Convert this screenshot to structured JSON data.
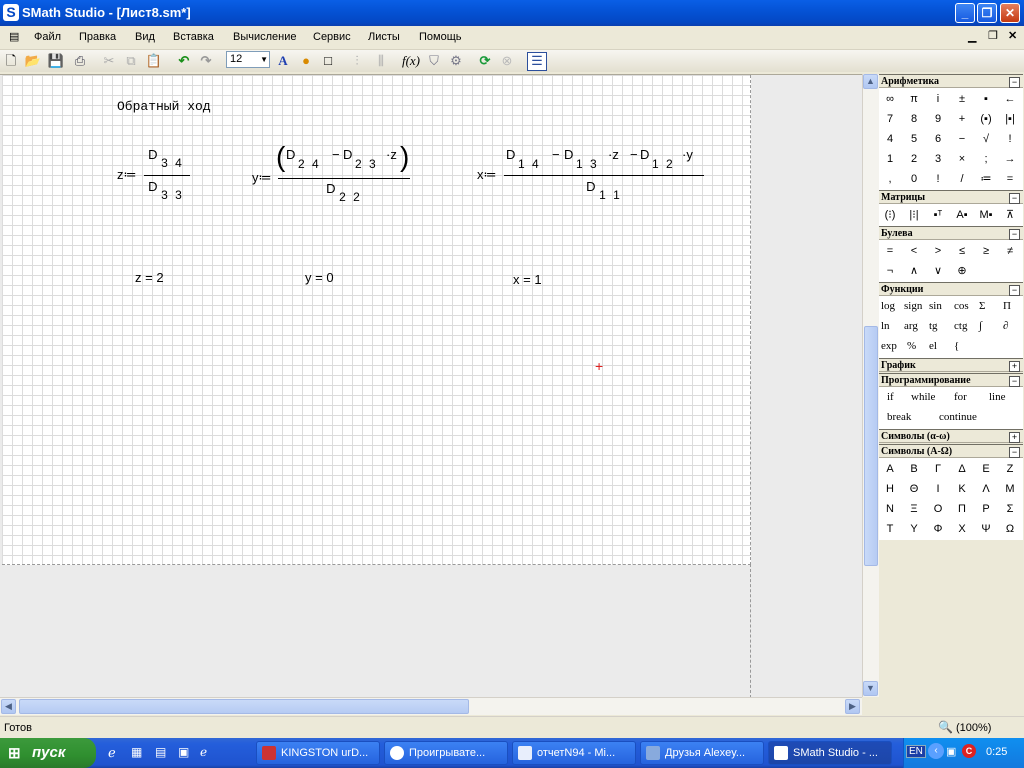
{
  "window": {
    "title": "SMath Studio - [Лист8.sm*]",
    "app_icon": "S"
  },
  "menu": [
    "Файл",
    "Правка",
    "Вид",
    "Вставка",
    "Вычисление",
    "Сервис",
    "Листы",
    "Помощь"
  ],
  "toolbar": {
    "font_size": "12",
    "fx_label": "f(x)",
    "text_label": "A"
  },
  "sheet": {
    "heading": "Обратный ход",
    "eq_z": {
      "lhs": "z",
      "assign": "≔",
      "num_var": "D",
      "num_sub": "3 4",
      "den_var": "D",
      "den_sub": "3 3"
    },
    "eq_y": {
      "lhs": "y",
      "assign": "≔",
      "num_text_a": "D",
      "num_sub_a": "2 4",
      "num_minus": "−",
      "num_text_b": "D",
      "num_sub_b": "2 3",
      "num_tail": "·z",
      "den_var": "D",
      "den_sub": "2 2"
    },
    "eq_x": {
      "lhs": "x",
      "assign": "≔",
      "d1": "D",
      "s1": "1 4",
      "m1": "−",
      "d2": "D",
      "s2": "1 3",
      "t2": "·z",
      "m2": "−",
      "d3": "D",
      "s3": "1 2",
      "t3": "·y",
      "den_var": "D",
      "den_sub": "1 1"
    },
    "result_z": "z = 2",
    "result_y": "y = 0",
    "result_x": "x = 1",
    "cursor": "+"
  },
  "panel": {
    "arithmetic": {
      "title": "Арифметика",
      "cells": [
        "∞",
        "π",
        "i",
        "±",
        "▪",
        "←",
        "7",
        "8",
        "9",
        "+",
        "(▪)",
        "|▪|",
        "4",
        "5",
        "6",
        "−",
        "√",
        "!",
        "1",
        "2",
        "3",
        "×",
        ";",
        "→",
        ",",
        "0",
        "!",
        "/",
        "≔",
        "="
      ]
    },
    "matrices": {
      "title": "Матрицы",
      "cells": [
        "(⁝)",
        "|⁝|",
        "▪ᵀ",
        "A▪",
        "M▪",
        "⊼"
      ]
    },
    "boolean": {
      "title": "Булева",
      "cells": [
        "=",
        "<",
        ">",
        "≤",
        "≥",
        "≠",
        "¬",
        "∧",
        "∨",
        "⊕"
      ]
    },
    "functions": {
      "title": "Функции",
      "cells": [
        "log",
        "sign",
        "sin",
        "cos",
        "Σ",
        "Π",
        "ln",
        "arg",
        "tg",
        "ctg",
        "∫",
        "∂",
        "exp",
        "%",
        "el",
        "{"
      ]
    },
    "graph": {
      "title": "График"
    },
    "programming": {
      "title": "Программирование",
      "cells": [
        "if",
        "while",
        "for",
        "line",
        "break",
        "continue"
      ]
    },
    "greek_lower": {
      "title": "Символы (α-ω)"
    },
    "greek_upper": {
      "title": "Символы (Α-Ω)",
      "cells": [
        "Α",
        "Β",
        "Γ",
        "Δ",
        "Ε",
        "Ζ",
        "Η",
        "Θ",
        "Ι",
        "Κ",
        "Λ",
        "Μ",
        "Ν",
        "Ξ",
        "Ο",
        "Π",
        "Ρ",
        "Σ",
        "Τ",
        "Υ",
        "Φ",
        "Χ",
        "Ψ",
        "Ω"
      ]
    }
  },
  "status": {
    "left": "Готов",
    "zoom": "(100%)"
  },
  "taskbar": {
    "start": "пуск",
    "tasks": [
      "KINGSTON urD...",
      "Проигрывате...",
      "отчетN94 - Mi...",
      "Друзья Alexey...",
      "SMath Studio - ..."
    ],
    "lang": "EN",
    "time": "0:25"
  }
}
